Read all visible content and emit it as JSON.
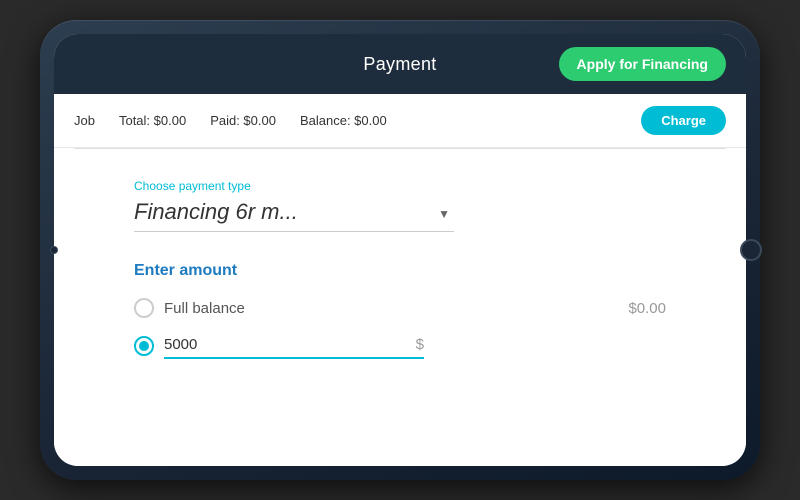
{
  "header": {
    "title": "Payment",
    "apply_financing_label": "Apply for Financing"
  },
  "summary_bar": {
    "job_label": "Job",
    "total_label": "Total: $0.00",
    "paid_label": "Paid: $0.00",
    "balance_label": "Balance: $0.00",
    "charge_label": "Charge"
  },
  "payment_type": {
    "field_label": "Choose payment type",
    "selected_value": "Financing 6r m..."
  },
  "enter_amount": {
    "section_title": "Enter amount",
    "full_balance_label": "Full balance",
    "full_balance_amount": "$0.00",
    "custom_amount_value": "5000",
    "currency_symbol": "$"
  }
}
